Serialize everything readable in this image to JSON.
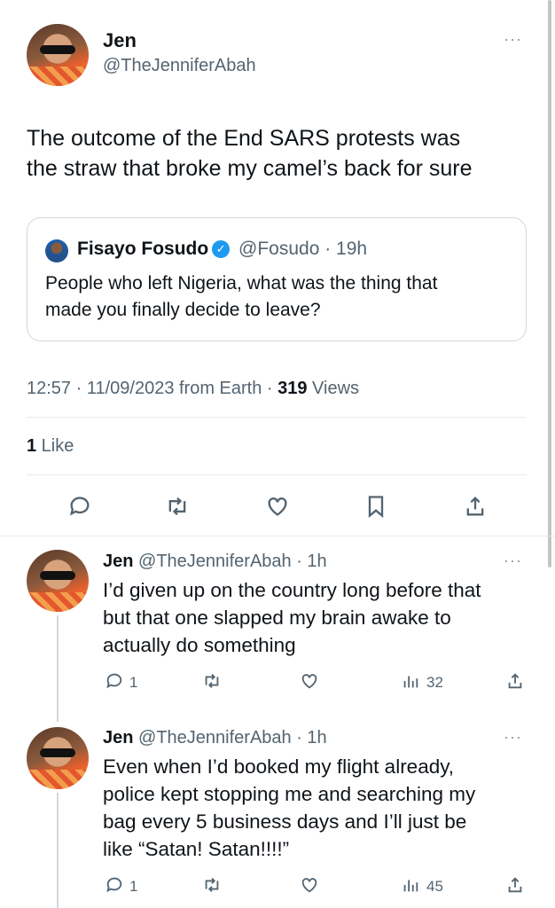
{
  "main_tweet": {
    "name": "Jen",
    "handle": "@TheJenniferAbah",
    "more": "···",
    "text_line1": "The outcome of the End SARS protests was",
    "text_line2": "the straw that broke my camel’s back for sure",
    "quote": {
      "name": "Fisayo Fosudo",
      "verified_glyph": "✓",
      "handle_time": "@Fosudo · 19h",
      "text_line1": "People who left Nigeria, what was the thing that",
      "text_line2": "made you finally decide to leave?"
    },
    "meta_prefix": "12:57 · 11/09/2023 from Earth · ",
    "views_count": "319",
    "views_label": " Views",
    "likes_count": "1",
    "likes_label": " Like"
  },
  "replies": [
    {
      "name": "Jen",
      "handle_time": "@TheJenniferAbah · 1h",
      "more": "···",
      "line1": "I’d given up on the country long before that",
      "line2": "but that one slapped my brain awake to",
      "line3": "actually do something",
      "reply_count": "1",
      "views_count": "32"
    },
    {
      "name": "Jen",
      "handle_time": "@TheJenniferAbah · 1h",
      "more": "···",
      "line1": "Even when I’d booked my flight already,",
      "line2": "police kept stopping me and searching my",
      "line3": "bag every 5 business days and I’ll just be",
      "line4": "like “Satan! Satan!!!!”",
      "reply_count": "1",
      "views_count": "45"
    }
  ],
  "icons": [
    "comment-icon",
    "retweet-icon",
    "heart-icon",
    "bookmark-icon",
    "share-icon",
    "views-icon",
    "more-icon"
  ],
  "colors": {
    "text": "#0f1419",
    "secondary": "#536471",
    "verified": "#1d9bf0",
    "border": "#cfd9de"
  }
}
